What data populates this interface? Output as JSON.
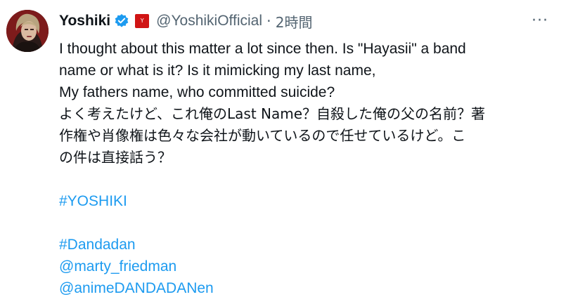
{
  "author": {
    "name": "Yoshiki",
    "handle": "@YoshikiOfficial",
    "separator": "·",
    "time": "2時間",
    "verified": true,
    "affiliate_badge_color": "#d01414",
    "affiliate_badge_text": "Y"
  },
  "tweet": {
    "lines_en": [
      "I thought about this matter a lot since then. Is \"Hayasii\" a band",
      "name or what is it? Is it mimicking my last name,",
      "My fathers name, who committed suicide?"
    ],
    "lines_jp": [
      "よく考えたけど、これ俺のLast Name？自殺した俺の父の名前？著",
      "作権や肖像権は色々な会社が動いているので任せているけど。こ",
      "の件は直接話う？"
    ],
    "hashtag": "#YOSHIKI",
    "hashtag2": "#Dandadan",
    "mention1": "@marty_friedman",
    "mention2": "@animeDANDADANen"
  },
  "icons": {
    "more": "more-icon",
    "verified": "verified-badge-icon",
    "affiliate": "affiliate-badge-icon"
  },
  "colors": {
    "text": "#0f1419",
    "secondary": "#536471",
    "link": "#1d9bf0",
    "verified": "#1d9bf0"
  }
}
